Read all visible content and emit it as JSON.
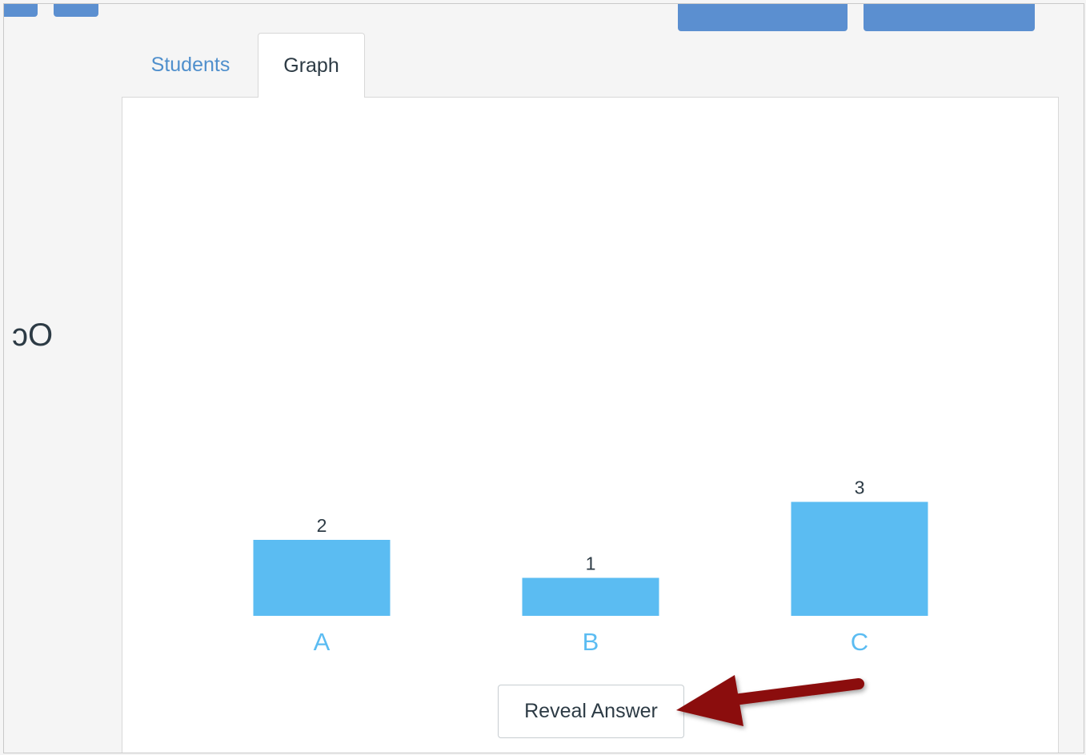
{
  "left_cut_text": "ɔO",
  "tabs": [
    {
      "label": "Students"
    },
    {
      "label": "Graph"
    }
  ],
  "chart_data": {
    "type": "bar",
    "categories": [
      "A",
      "B",
      "C"
    ],
    "values": [
      2,
      1,
      3
    ],
    "data_labels": [
      "2",
      "1",
      "3"
    ],
    "ylim": [
      0,
      3
    ],
    "bar_color": "#5bbcf2",
    "category_label_color": "#5bbcf2"
  },
  "reveal_button": {
    "label": "Reveal Answer"
  },
  "colors": {
    "accent": "#5b8fd0",
    "tab_link": "#4f8fcc",
    "annotation_arrow": "#8b0a0a"
  }
}
